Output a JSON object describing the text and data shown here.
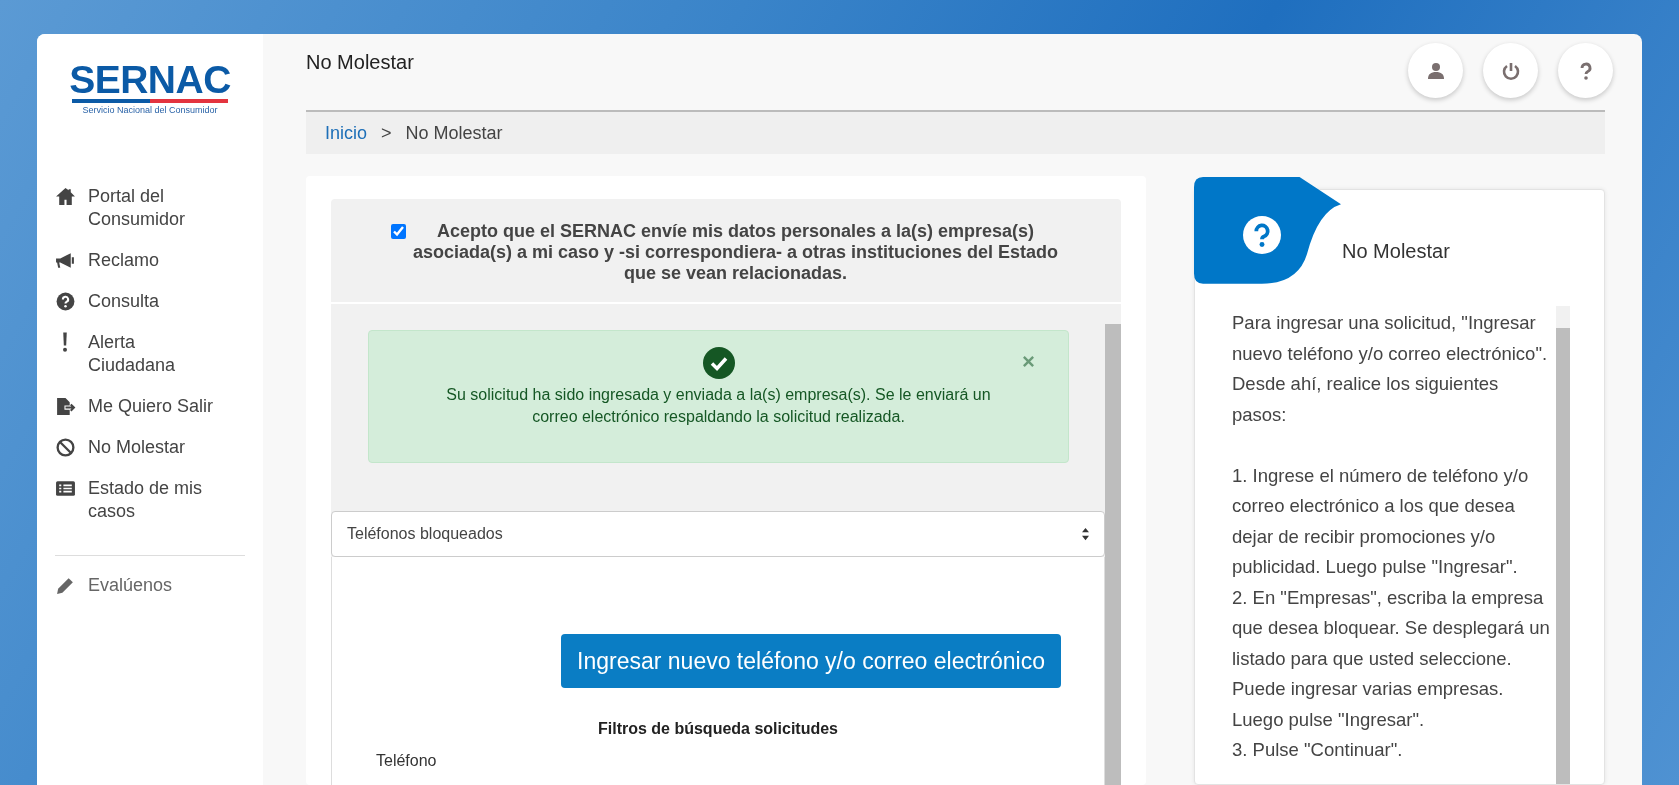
{
  "logo": {
    "name": "SERNAC",
    "subtitle": "Servicio Nacional del Consumidor"
  },
  "sidebar": {
    "items": [
      {
        "label": "Portal del Consumidor",
        "kind": "home"
      },
      {
        "label": "Reclamo",
        "kind": "megaphone"
      },
      {
        "label": "Consulta",
        "kind": "question"
      },
      {
        "label": "Alerta Ciudadana",
        "kind": "exclamation"
      },
      {
        "label": "Me Quiero Salir",
        "kind": "exit"
      },
      {
        "label": "No Molestar",
        "kind": "ban"
      },
      {
        "label": "Estado de mis casos",
        "kind": "list"
      }
    ],
    "footer_item": {
      "label": "Evalúenos"
    }
  },
  "header": {
    "title": "No Molestar"
  },
  "breadcrumb": {
    "items": [
      {
        "label": "Inicio"
      },
      {
        "label": "No Molestar"
      }
    ],
    "separator": ">"
  },
  "consent": {
    "checked": true,
    "text": "Acepto que el SERNAC envíe mis datos personales a la(s) empresa(s) asociada(s) a mi caso y -si correspondiera- a otras instituciones del Estado que se vean relacionadas."
  },
  "alert": {
    "message": "Su solicitud ha sido ingresada y enviada a la(s) empresa(s). Se le enviará un correo electrónico respaldando la solicitud realizada."
  },
  "select": {
    "value": "Teléfonos bloqueados"
  },
  "new_button": "Ingresar nuevo teléfono y/o correo electrónico",
  "filters": {
    "title": "Filtros de búsqueda solicitudes",
    "fields": [
      {
        "label": "Teléfono"
      }
    ]
  },
  "help": {
    "title": "No Molestar",
    "intro": "Para ingresar una solicitud, \"Ingresar nuevo teléfono y/o correo electrónico\". Desde ahí, realice los siguientes pasos:",
    "steps": [
      "1. Ingrese el número de teléfono y/o correo electrónico a los que desea dejar de recibir promociones y/o publicidad. Luego pulse \"Ingresar\".",
      "2. En \"Empresas\", escriba la empresa que desea bloquear. Se desplegará un listado para que usted seleccione. Puede ingresar varias empresas. Luego pulse \"Ingresar\".",
      "3. Pulse \"Continuar\"."
    ]
  }
}
